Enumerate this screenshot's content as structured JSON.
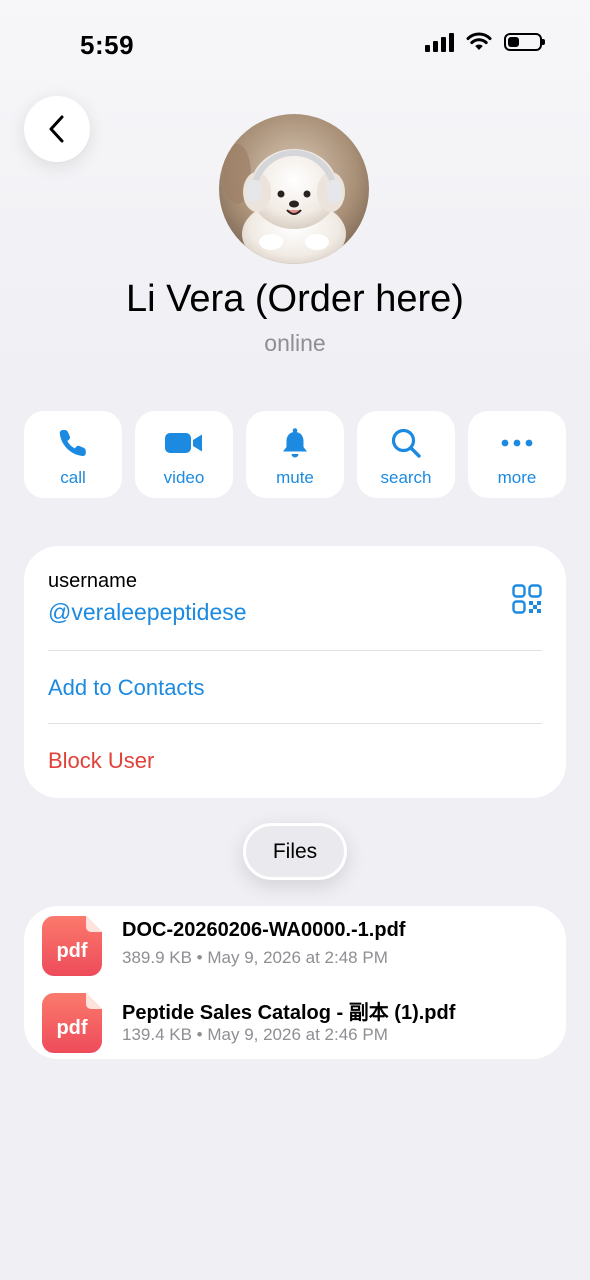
{
  "status_bar": {
    "time": "5:59",
    "battery_level": 0.35
  },
  "contact": {
    "name": "Li Vera (Order here)",
    "status": "online"
  },
  "actions": [
    {
      "label": "call",
      "icon": "phone-icon"
    },
    {
      "label": "video",
      "icon": "video-camera-icon"
    },
    {
      "label": "mute",
      "icon": "bell-icon"
    },
    {
      "label": "search",
      "icon": "magnifier-icon"
    },
    {
      "label": "more",
      "icon": "ellipsis-icon"
    }
  ],
  "info": {
    "username_label": "username",
    "username_value": "@veraleepeptidese",
    "add_to_contacts": "Add to Contacts",
    "block_user": "Block User"
  },
  "files_tab": {
    "label": "Files"
  },
  "files": [
    {
      "type_label": "pdf",
      "name": "DOC-20260206-WA0000.-1.pdf",
      "size": "389.9 KB",
      "date": "May 9, 2026 at 2:48 PM"
    },
    {
      "type_label": "pdf",
      "name": "Peptide Sales Catalog - 副本 (1).pdf",
      "size": "139.4 KB",
      "date": "May 9, 2026 at 2:46 PM"
    }
  ],
  "colors": {
    "accent": "#1c8ae0",
    "destructive": "#e0423a",
    "background": "#efeff4",
    "secondary_text": "#8e8e93",
    "pdf_gradient_top": "#fb7a6c",
    "pdf_gradient_bottom": "#ee4b5a"
  }
}
